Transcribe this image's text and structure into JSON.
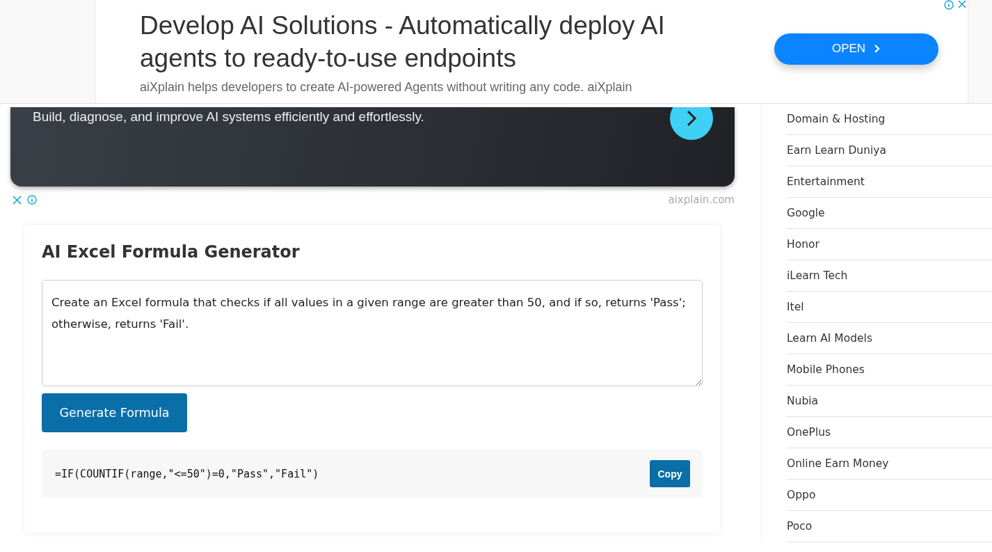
{
  "top_ad": {
    "headline": "Develop AI Solutions - Automatically deploy AI agents to ready-to-use endpoints",
    "description": "aiXplain helps developers to create AI-powered Agents without writing any code. aiXplain",
    "button": "OPEN"
  },
  "dark_ad": {
    "text": "Build, diagnose, and improve AI systems efficiently and effortlessly.",
    "domain": "aixplain.com"
  },
  "generator": {
    "title": "AI Excel Formula Generator",
    "prompt": "Create an Excel formula that checks if all values in a given range are greater than 50, and if so, returns 'Pass'; otherwise, returns 'Fail'.",
    "button": "Generate Formula",
    "result": "=IF(COUNTIF(range,\"<=50\")=0,\"Pass\",\"Fail\")",
    "copy_button": "Copy"
  },
  "sidebar": {
    "items": [
      "Domain & Hosting",
      "Earn Learn Duniya",
      "Entertainment",
      "Google",
      "Honor",
      "iLearn Tech",
      "Itel",
      "Learn AI Models",
      "Mobile Phones",
      "Nubia",
      "OnePlus",
      "Online Earn Money",
      "Oppo",
      "Poco"
    ]
  }
}
